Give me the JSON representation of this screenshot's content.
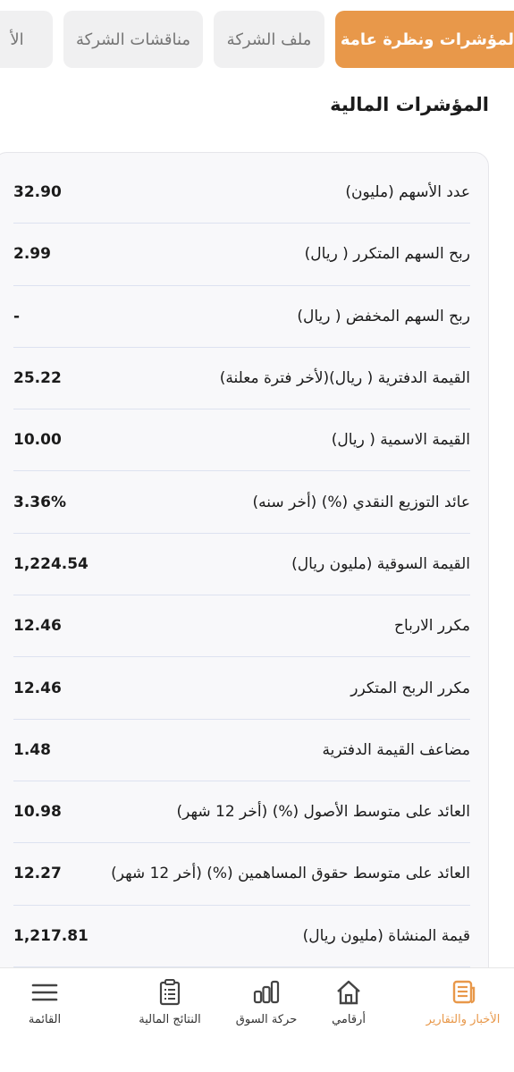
{
  "tabs": [
    {
      "label": "المؤشرات ونظرة عامة",
      "active": true
    },
    {
      "label": "ملف الشركة",
      "active": false
    },
    {
      "label": "مناقشات الشركة",
      "active": false
    },
    {
      "label": "الأ",
      "active": false
    }
  ],
  "section_title": "المؤشرات المالية",
  "indicators": [
    {
      "label": "عدد الأسهم (مليون)",
      "value": "32.90"
    },
    {
      "label": "ربح السهم المتكرر ( ريال)",
      "value": "2.99"
    },
    {
      "label": "ربح السهم المخفض ( ريال)",
      "value": "-"
    },
    {
      "label": "القيمة الدفترية  ( ريال)(لأخر فترة معلنة)",
      "value": "25.22"
    },
    {
      "label": "القيمة الاسمية ( ريال)",
      "value": "10.00"
    },
    {
      "label": "عائد التوزيع النقدي (%) (أخر سنه)",
      "value": "3.36%"
    },
    {
      "label": "القيمة السوقية (مليون ريال)",
      "value": "1,224.54"
    },
    {
      "label": "مكرر الارباح",
      "value": "12.46"
    },
    {
      "label": "مكرر الربح المتكرر",
      "value": "12.46"
    },
    {
      "label": "مضاعف القيمة الدفترية",
      "value": "1.48"
    },
    {
      "label": "العائد على متوسط الأصول (%) (أخر 12 شهر)",
      "value": "10.98"
    },
    {
      "label": "العائد على متوسط حقوق المساهمين (%) (أخر 12 شهر)",
      "value": "12.27"
    },
    {
      "label": "قيمة المنشاة (مليون ريال)",
      "value": "1,217.81"
    }
  ],
  "bottom_nav": [
    {
      "label": "الأخبار والتقارير",
      "icon": "news-icon",
      "active": true
    },
    {
      "label": "أرقامي",
      "icon": "home-icon",
      "active": false
    },
    {
      "label": "حركة السوق",
      "icon": "bar-chart-icon",
      "active": false
    },
    {
      "label": "النتائج المالية",
      "icon": "clipboard-icon",
      "active": false
    },
    {
      "label": "القائمة",
      "icon": "menu-icon",
      "active": false
    }
  ],
  "colors": {
    "accent": "#e8984a",
    "tab_bg": "#f0f0f1",
    "card_bg": "#f8f8fa"
  }
}
